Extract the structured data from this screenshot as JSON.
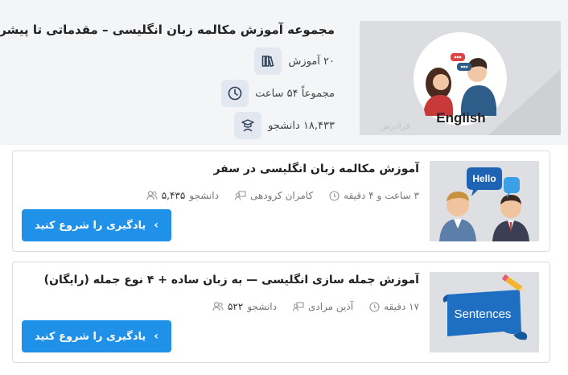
{
  "collection": {
    "title": "مجموعه آموزش مکالمه زبان انگلیسی – مقدماتی تا پیشرفته",
    "thumb_caption": "English",
    "thumb_watermark": "فرادرس",
    "meta": [
      {
        "icon": "books-icon",
        "text": "۲۰ آموزش"
      },
      {
        "icon": "clock-icon",
        "text": "مجموعاً ۵۴ ساعت"
      },
      {
        "icon": "graduate-icon",
        "text": "۱۸,۴۳۳ دانشجو"
      }
    ]
  },
  "courses": [
    {
      "title": "آموزش مکالمه زبان انگلیسی در سفر",
      "students": "۵,۴۳۵",
      "students_suffix": "دانشجو",
      "teacher": "کامران کرودهی",
      "duration": "۳ ساعت و ۴ دقیقه",
      "button": "یادگیری را شروع کنید",
      "thumb_text": "Hello"
    },
    {
      "title": "آموزش جمله سازی انگلیسی — به زبان ساده + ۴ نوع جمله (رایگان)",
      "students": "۵۲۲",
      "students_suffix": "دانشجو",
      "teacher": "آذین مرادی",
      "duration": "۱۷ دقیقه",
      "button": "یادگیری را شروع کنید",
      "thumb_text": "Sentences"
    }
  ],
  "colors": {
    "accent": "#2091e8",
    "meta_icon_bg": "#e3e8f0",
    "header_bg": "#f4f5f7"
  }
}
